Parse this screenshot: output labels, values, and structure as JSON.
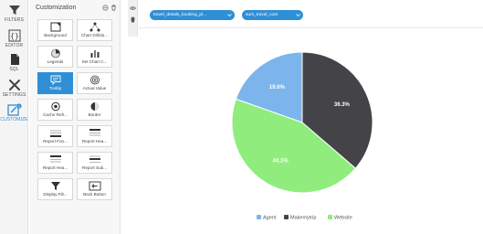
{
  "rail": {
    "items": [
      {
        "label": "FILTERS",
        "icon": "funnel-icon"
      },
      {
        "label": "EDITOR",
        "icon": "braces-icon"
      },
      {
        "label": "SQL",
        "icon": "sql-file-icon"
      },
      {
        "label": "SETTINGS",
        "icon": "wrench-cross-icon"
      },
      {
        "label": "CUSTOMIZE",
        "icon": "edit-square-icon",
        "badge": "1",
        "active": true
      }
    ]
  },
  "panel": {
    "title": "Customization",
    "tiles": [
      {
        "label": "Background",
        "icon": "background-icon"
      },
      {
        "label": "Chart Drilldo...",
        "icon": "drilldown-icon"
      },
      {
        "label": "Legends",
        "icon": "legend-pie-icon"
      },
      {
        "label": "Set Chart C...",
        "icon": "chart-color-icon"
      },
      {
        "label": "Tooltip",
        "icon": "tooltip-icon",
        "selected": true
      },
      {
        "label": "Actual Value",
        "icon": "target-icon"
      },
      {
        "label": "Cache Refr...",
        "icon": "cache-icon"
      },
      {
        "label": "Border",
        "icon": "border-icon"
      },
      {
        "label": "Report Foo...",
        "icon": "report-footer-icon"
      },
      {
        "label": "Report Hea...",
        "icon": "report-header-icon"
      },
      {
        "label": "Report Hea...",
        "icon": "report-header-icon"
      },
      {
        "label": "Report Sub...",
        "icon": "report-subheader-icon"
      },
      {
        "label": "Display Filt...",
        "icon": "display-filter-icon"
      },
      {
        "label": "Back Button",
        "icon": "back-button-icon"
      }
    ]
  },
  "chips": [
    {
      "label": "travel_details_booking_pl..."
    },
    {
      "label": "sum_travel_cost"
    }
  ],
  "colors": {
    "accent": "#2f8fd6",
    "agent": "#7cb5ec",
    "makemytrip": "#434348",
    "website": "#90ed7d"
  },
  "chart_data": {
    "type": "pie",
    "series": [
      {
        "name": "Agent",
        "value": 19.6,
        "label": "19.6%",
        "color": "#7cb5ec"
      },
      {
        "name": "Makemytrip",
        "value": 36.3,
        "label": "36.3%",
        "color": "#434348"
      },
      {
        "name": "Website",
        "value": 44.1,
        "label": "44.1%",
        "color": "#90ed7d"
      }
    ],
    "legend_placement": "bottom"
  }
}
